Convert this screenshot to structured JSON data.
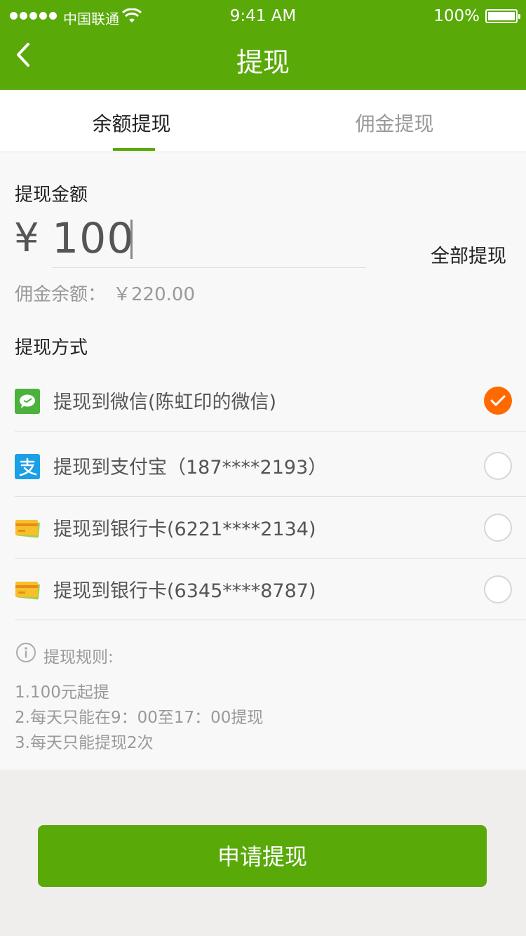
{
  "status_bar": {
    "carrier": "中国联通",
    "time": "9:41 AM",
    "battery": "100%"
  },
  "nav": {
    "title": "提现"
  },
  "tabs": [
    {
      "label": "余额提现",
      "active": true
    },
    {
      "label": "佣金提现",
      "active": false
    }
  ],
  "amount_section": {
    "label": "提现金额",
    "currency": "¥",
    "value": "100",
    "withdraw_all": "全部提现",
    "balance_label": "佣金余额：",
    "balance_value": "￥220.00"
  },
  "methods": {
    "label": "提现方式",
    "items": [
      {
        "label": "提现到微信(陈虹印的微信)",
        "icon": "wechat-icon",
        "checked": true
      },
      {
        "label": "提现到支付宝（187****2193）",
        "icon": "alipay-icon",
        "checked": false
      },
      {
        "label": "提现到银行卡(6221****2134)",
        "icon": "bank-card-icon",
        "checked": false
      },
      {
        "label": "提现到银行卡(6345****8787)",
        "icon": "bank-card-icon",
        "checked": false
      }
    ]
  },
  "rules": {
    "title": "提现规则:",
    "items": [
      "1.100元起提",
      "2.每天只能在9：00至17：00提现",
      "3.每天只能提现2次"
    ]
  },
  "submit": {
    "label": "申请提现"
  },
  "colors": {
    "brand_green": "#59a909",
    "check_orange": "#ff6a00"
  }
}
